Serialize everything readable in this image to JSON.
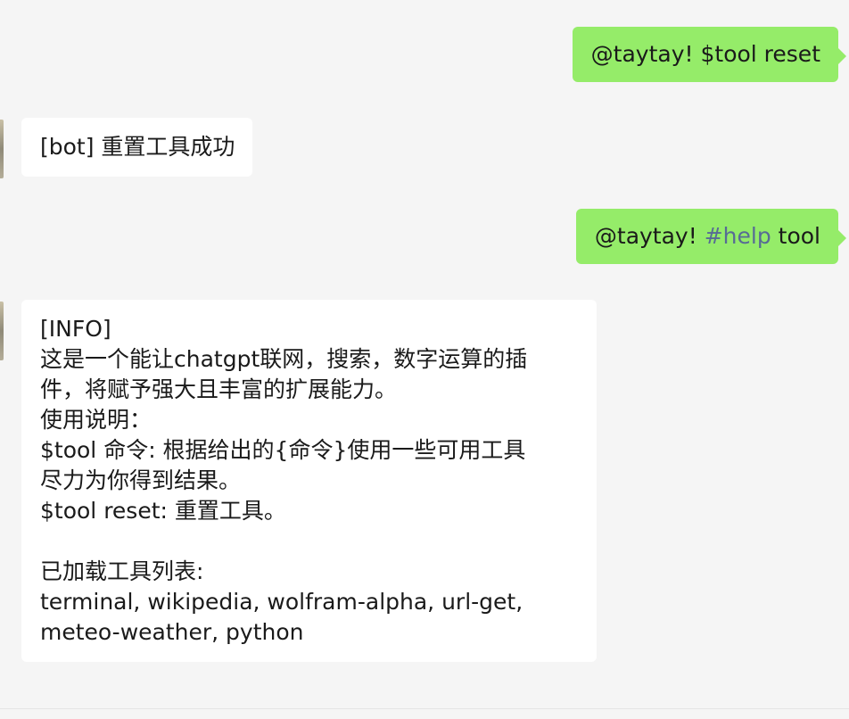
{
  "messages": [
    {
      "side": "right",
      "mention": "@taytay",
      "separator": "! ",
      "text": "$tool reset"
    },
    {
      "side": "left",
      "text": "[bot] 重置工具成功"
    },
    {
      "side": "right",
      "mention": "@taytay",
      "separator": "! ",
      "hashtag": "#help",
      "text_after": " tool"
    },
    {
      "side": "left",
      "lines": [
        "[INFO]",
        "这是一个能让chatgpt联网，搜索，数字运算的插",
        "件，将赋予强大且丰富的扩展能力。",
        "使用说明：",
        "$tool 命令: 根据给出的{命令}使用一些可用工具",
        "尽力为你得到结果。",
        "$tool reset: 重置工具。",
        "",
        "已加载工具列表:",
        "terminal, wikipedia, wolfram-alpha, url-get,",
        "meteo-weather, python"
      ]
    }
  ],
  "colors": {
    "background": "#f5f5f5",
    "sent_bubble": "#95ec69",
    "received_bubble": "#ffffff",
    "hashtag": "#576b95"
  }
}
